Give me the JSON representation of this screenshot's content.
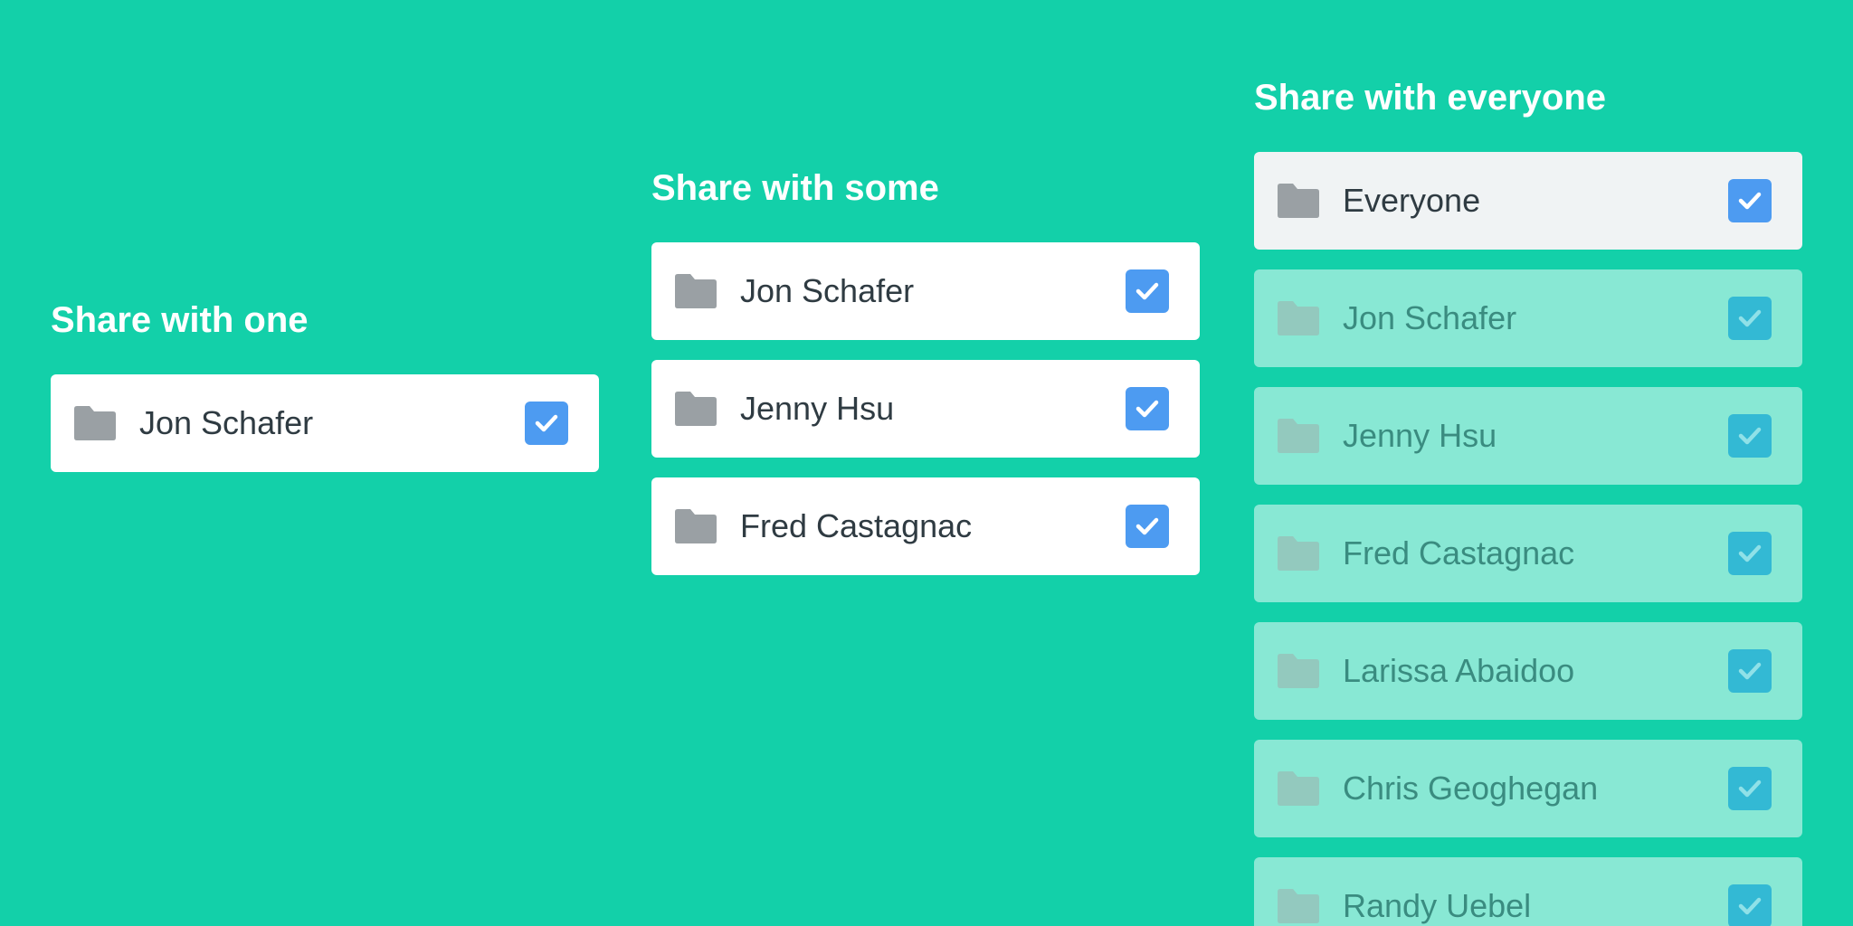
{
  "colors": {
    "background": "#13d0a9",
    "card": "#ffffff",
    "card_selected": "#f0f3f4",
    "card_dimmed": "#88e8d4",
    "checkbox": "#4d9bf1",
    "checkbox_dimmed": "#33b9d4",
    "folder": "#9aa0a4"
  },
  "icons": {
    "folder": "folder-icon",
    "check": "checkmark-icon"
  },
  "groups": {
    "one": {
      "title": "Share with one",
      "items": [
        {
          "label": "Jon Schafer",
          "checked": true
        }
      ]
    },
    "some": {
      "title": "Share with some",
      "items": [
        {
          "label": "Jon Schafer",
          "checked": true
        },
        {
          "label": "Jenny Hsu",
          "checked": true
        },
        {
          "label": "Fred Castagnac",
          "checked": true
        }
      ]
    },
    "everyone": {
      "title": "Share with everyone",
      "items": [
        {
          "label": "Everyone",
          "checked": true
        },
        {
          "label": "Jon Schafer",
          "checked": true
        },
        {
          "label": "Jenny Hsu",
          "checked": true
        },
        {
          "label": "Fred Castagnac",
          "checked": true
        },
        {
          "label": "Larissa Abaidoo",
          "checked": true
        },
        {
          "label": "Chris Geoghegan",
          "checked": true
        },
        {
          "label": "Randy Uebel",
          "checked": true
        }
      ]
    }
  }
}
